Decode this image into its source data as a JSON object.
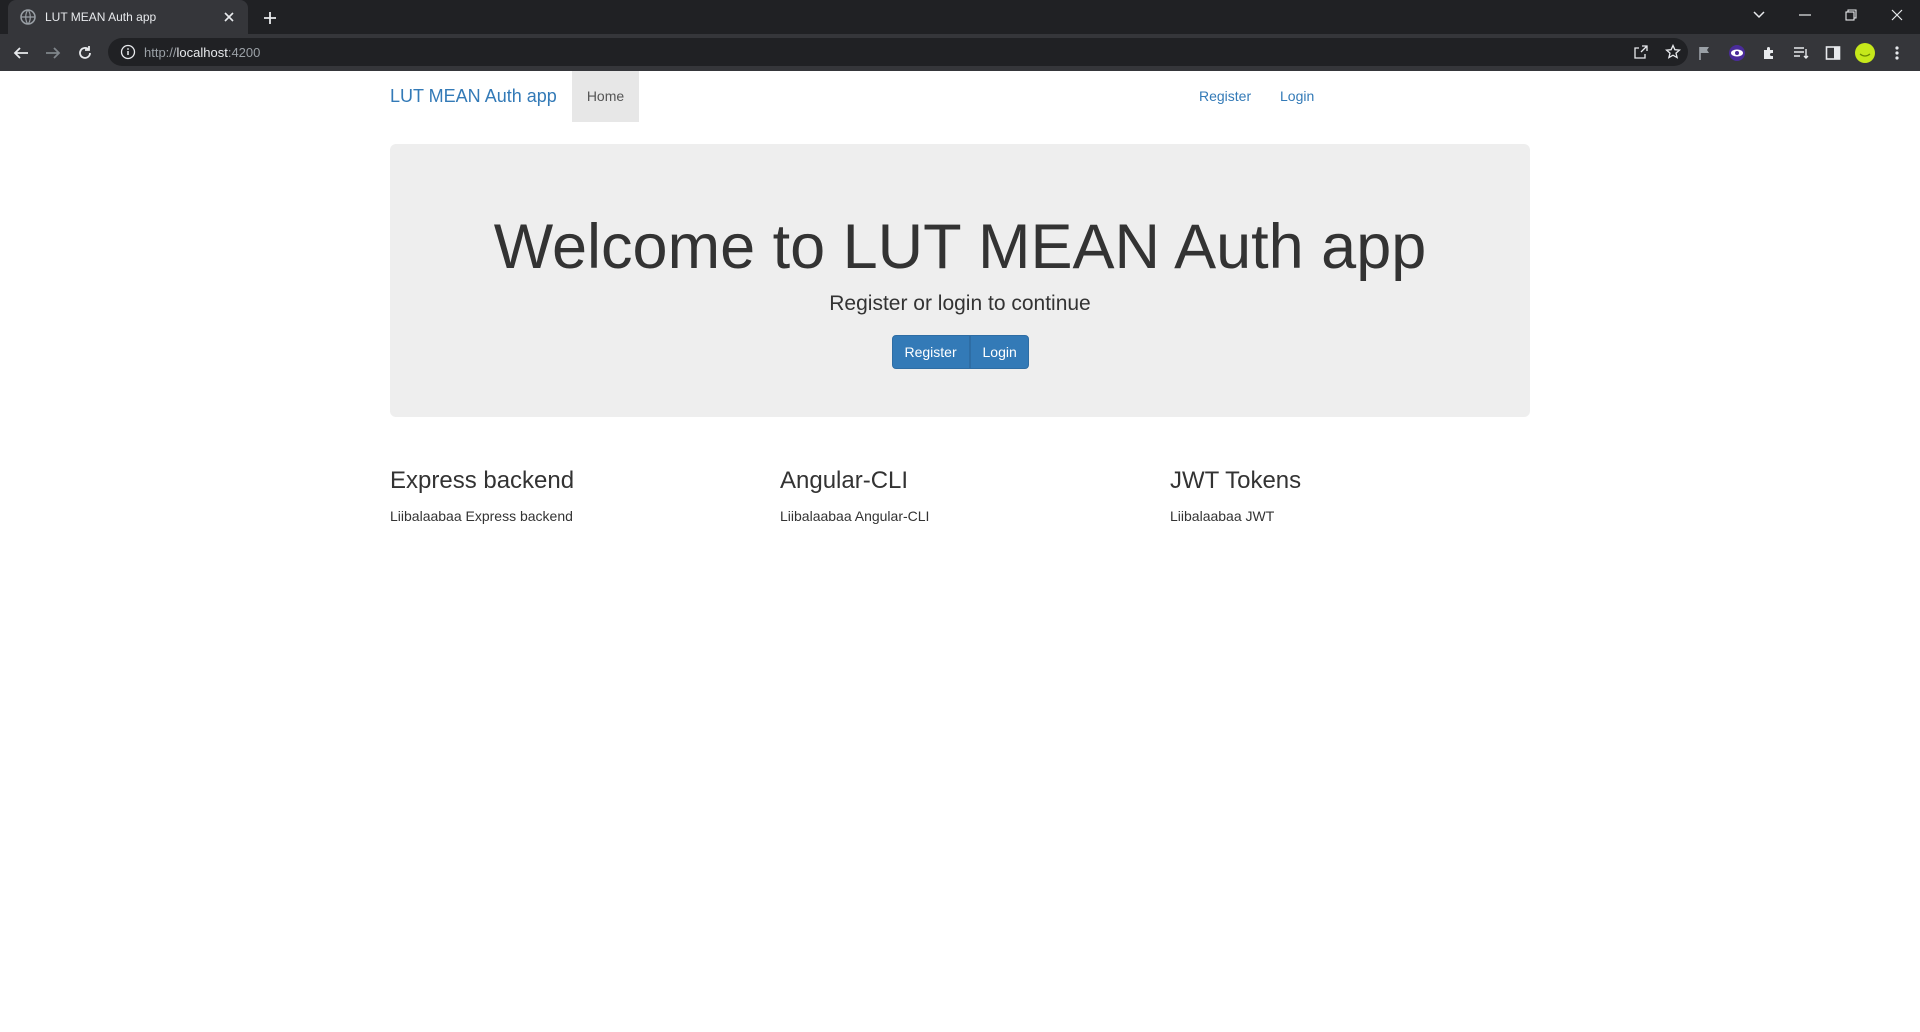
{
  "browser": {
    "tab_title": "LUT MEAN Auth app",
    "url_scheme": "http://",
    "url_host": "localhost",
    "url_port": ":4200"
  },
  "navbar": {
    "brand": "LUT MEAN Auth app",
    "home": "Home",
    "register": "Register",
    "login": "Login"
  },
  "jumbotron": {
    "heading": "Welcome to LUT MEAN Auth app",
    "subtitle": "Register or login to continue",
    "register_button": "Register",
    "login_button": "Login"
  },
  "features": [
    {
      "title": "Express backend",
      "text": "Liibalaabaa Express backend"
    },
    {
      "title": "Angular-CLI",
      "text": "Liibalaabaa Angular-CLI"
    },
    {
      "title": "JWT Tokens",
      "text": "Liibalaabaa JWT"
    }
  ],
  "colors": {
    "primary": "#337ab7",
    "jumbotron_bg": "#eeeeee",
    "chrome_dark": "#202124",
    "chrome_mid": "#35363a",
    "profile_avatar": "#c6e81b"
  }
}
